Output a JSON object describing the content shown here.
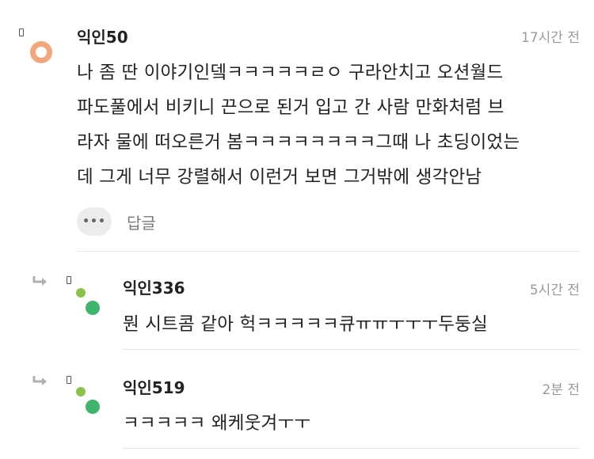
{
  "comments": [
    {
      "author": "익인50",
      "time": "17시간 전",
      "lines": [
        "나 좀 딴 이야기인뎈ㅋㅋㅋㅋㅋㄹㅇ 구라안치고 오션월드",
        "파도풀에서 비키니 끈으로 된거 입고 간 사람 만화처럼 브",
        "라자 물에 떠오른거 봄ㅋㅋㅋㅋㅋㅋㅋㅋ그때 나 초딩이었는",
        "데 그게 너무 강렬해서 이런거 보면 그거밖에 생각안남"
      ],
      "more_label": "•••",
      "reply_label": "답글"
    }
  ],
  "replies": [
    {
      "author": "익인336",
      "time": "5시간 전",
      "text": "뭔 시트콤 같아 헉ㅋㅋㅋㅋㅋ큐ㅠㅠㅜㅜㅜ두둥실"
    },
    {
      "author": "익인519",
      "time": "2분 전",
      "text": "ㅋㅋㅋㅋㅋ 왜케웃겨ㅜㅜ"
    }
  ],
  "colors": {
    "avatar_main": "#f2a67b",
    "avatar_dot_small": "#8bc34a",
    "avatar_dot_big": "#3fb56b",
    "time_text": "#9a9a9a",
    "divider": "#e6e6e6"
  },
  "icons": {
    "reply_arrow": "reply-arrow-icon",
    "more": "more-dots-icon"
  }
}
